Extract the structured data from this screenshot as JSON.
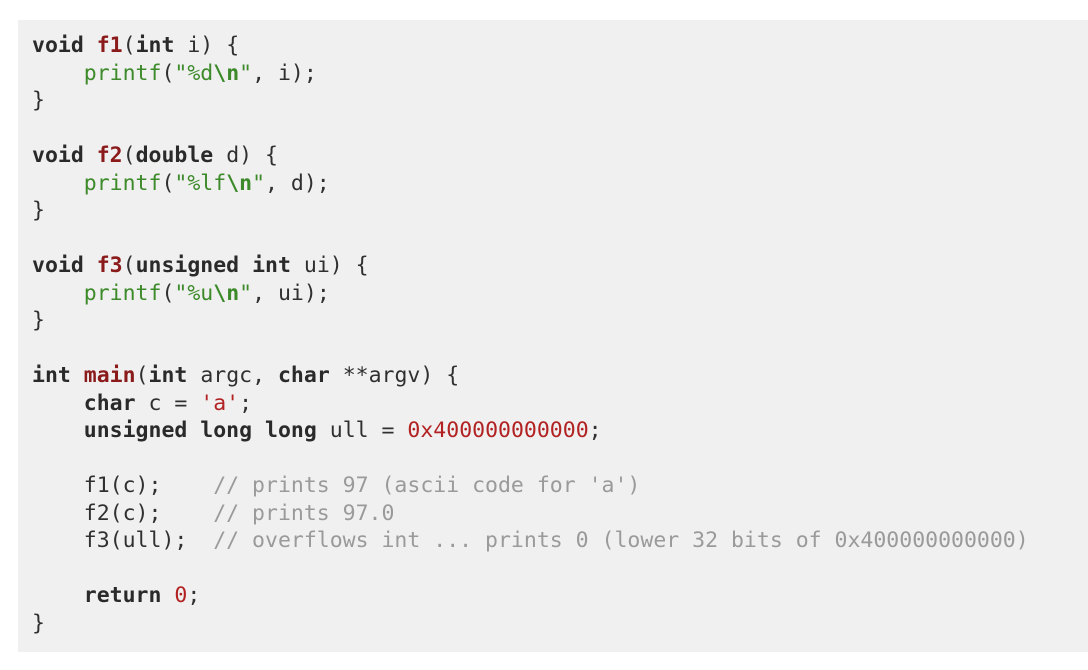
{
  "code": {
    "lines": [
      [
        {
          "t": "void",
          "c": "kw"
        },
        {
          "t": " ",
          "c": "plain"
        },
        {
          "t": "f1",
          "c": "fn"
        },
        {
          "t": "(",
          "c": "plain"
        },
        {
          "t": "int",
          "c": "kw"
        },
        {
          "t": " i) {",
          "c": "plain"
        }
      ],
      [
        {
          "t": "    ",
          "c": "plain"
        },
        {
          "t": "printf",
          "c": "call"
        },
        {
          "t": "(",
          "c": "plain"
        },
        {
          "t": "\"%d",
          "c": "str"
        },
        {
          "t": "\\n",
          "c": "esc"
        },
        {
          "t": "\"",
          "c": "str"
        },
        {
          "t": ", i);",
          "c": "plain"
        }
      ],
      [
        {
          "t": "}",
          "c": "plain"
        }
      ],
      [],
      [
        {
          "t": "void",
          "c": "kw"
        },
        {
          "t": " ",
          "c": "plain"
        },
        {
          "t": "f2",
          "c": "fn"
        },
        {
          "t": "(",
          "c": "plain"
        },
        {
          "t": "double",
          "c": "kw"
        },
        {
          "t": " d) {",
          "c": "plain"
        }
      ],
      [
        {
          "t": "    ",
          "c": "plain"
        },
        {
          "t": "printf",
          "c": "call"
        },
        {
          "t": "(",
          "c": "plain"
        },
        {
          "t": "\"%lf",
          "c": "str"
        },
        {
          "t": "\\n",
          "c": "esc"
        },
        {
          "t": "\"",
          "c": "str"
        },
        {
          "t": ", d);",
          "c": "plain"
        }
      ],
      [
        {
          "t": "}",
          "c": "plain"
        }
      ],
      [],
      [
        {
          "t": "void",
          "c": "kw"
        },
        {
          "t": " ",
          "c": "plain"
        },
        {
          "t": "f3",
          "c": "fn"
        },
        {
          "t": "(",
          "c": "plain"
        },
        {
          "t": "unsigned",
          "c": "kw"
        },
        {
          "t": " ",
          "c": "plain"
        },
        {
          "t": "int",
          "c": "kw"
        },
        {
          "t": " ui) {",
          "c": "plain"
        }
      ],
      [
        {
          "t": "    ",
          "c": "plain"
        },
        {
          "t": "printf",
          "c": "call"
        },
        {
          "t": "(",
          "c": "plain"
        },
        {
          "t": "\"%u",
          "c": "str"
        },
        {
          "t": "\\n",
          "c": "esc"
        },
        {
          "t": "\"",
          "c": "str"
        },
        {
          "t": ", ui);",
          "c": "plain"
        }
      ],
      [
        {
          "t": "}",
          "c": "plain"
        }
      ],
      [],
      [
        {
          "t": "int",
          "c": "kw"
        },
        {
          "t": " ",
          "c": "plain"
        },
        {
          "t": "main",
          "c": "fn"
        },
        {
          "t": "(",
          "c": "plain"
        },
        {
          "t": "int",
          "c": "kw"
        },
        {
          "t": " argc, ",
          "c": "plain"
        },
        {
          "t": "char",
          "c": "kw"
        },
        {
          "t": " **argv) {",
          "c": "plain"
        }
      ],
      [
        {
          "t": "    ",
          "c": "plain"
        },
        {
          "t": "char",
          "c": "kw"
        },
        {
          "t": " c = ",
          "c": "plain"
        },
        {
          "t": "'a'",
          "c": "chr"
        },
        {
          "t": ";",
          "c": "plain"
        }
      ],
      [
        {
          "t": "    ",
          "c": "plain"
        },
        {
          "t": "unsigned",
          "c": "kw"
        },
        {
          "t": " ",
          "c": "plain"
        },
        {
          "t": "long",
          "c": "kw"
        },
        {
          "t": " ",
          "c": "plain"
        },
        {
          "t": "long",
          "c": "kw"
        },
        {
          "t": " ull = ",
          "c": "plain"
        },
        {
          "t": "0x400000000000",
          "c": "num"
        },
        {
          "t": ";",
          "c": "plain"
        }
      ],
      [],
      [
        {
          "t": "    f1(c);    ",
          "c": "plain"
        },
        {
          "t": "// prints 97 (ascii code for 'a')",
          "c": "cmt"
        }
      ],
      [
        {
          "t": "    f2(c);    ",
          "c": "plain"
        },
        {
          "t": "// prints 97.0",
          "c": "cmt"
        }
      ],
      [
        {
          "t": "    f3(ull);  ",
          "c": "plain"
        },
        {
          "t": "// overflows int ... prints 0 (lower 32 bits of 0x400000000000)",
          "c": "cmt"
        }
      ],
      [],
      [
        {
          "t": "    ",
          "c": "plain"
        },
        {
          "t": "return",
          "c": "kw"
        },
        {
          "t": " ",
          "c": "plain"
        },
        {
          "t": "0",
          "c": "num"
        },
        {
          "t": ";",
          "c": "plain"
        }
      ],
      [
        {
          "t": "}",
          "c": "plain"
        }
      ]
    ]
  }
}
